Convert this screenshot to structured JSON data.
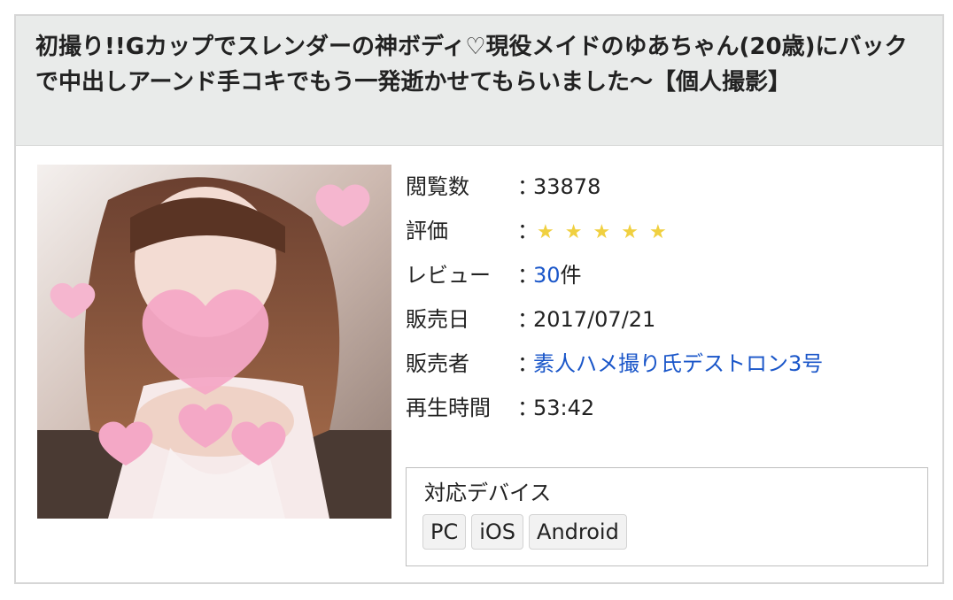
{
  "listing": {
    "title": "初撮り!!Gカップでスレンダーの神ボディ♡現役メイドのゆあちゃん(20歳)にバックで中出しアーンド手コキでもう一発逝かせてもらいました〜【個人撮影】"
  },
  "details": {
    "views_label": "閲覧数",
    "views_value": "33878",
    "rating_label": "評価",
    "rating_stars": 5,
    "star_glyph": "★",
    "reviews_label": "レビュー",
    "reviews_count": "30",
    "reviews_unit": "件",
    "release_label": "販売日",
    "release_value": "2017/07/21",
    "seller_label": "販売者",
    "seller_name": "素人ハメ撮り氏デストロン3号",
    "duration_label": "再生時間",
    "duration_value": "53:42",
    "separator": "："
  },
  "devices": {
    "title": "対応デバイス",
    "items": [
      "PC",
      "iOS",
      "Android"
    ]
  },
  "colors": {
    "link": "#1a56c9",
    "star": "#f0d040",
    "title_bar_bg": "#e9ebea"
  }
}
